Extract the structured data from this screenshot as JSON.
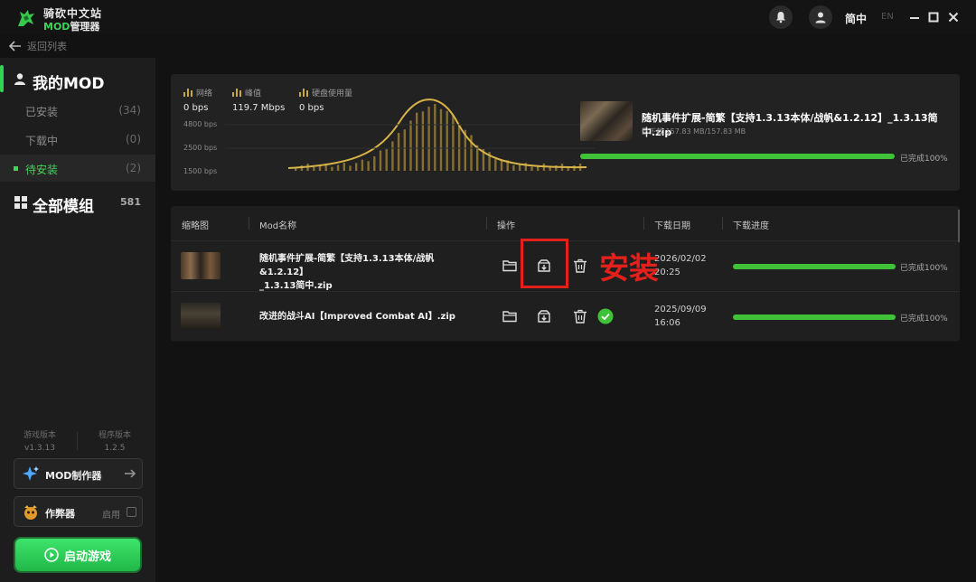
{
  "app": {
    "brand_line1": "骑砍中文站",
    "brand_mod": "MOD",
    "brand_mgr": "管理器",
    "lang_cn": "简中",
    "lang_en": "EN",
    "back_label": "返回列表"
  },
  "sidebar": {
    "my_mod": "我的MOD",
    "items": [
      {
        "label": "已安装",
        "count": "(34)"
      },
      {
        "label": "下载中",
        "count": "(0)"
      },
      {
        "label": "待安装",
        "count": "(2)"
      }
    ],
    "all_mods": "全部模组",
    "all_count": "581",
    "game_version_label": "游戏版本",
    "game_version": "v1.3.13",
    "app_version_label": "程序版本",
    "app_version": "1.2.5",
    "mod_maker": "MOD制作器",
    "cheat": "作弊器",
    "cheat_enable": "启用",
    "start_game": "启动游戏"
  },
  "download": {
    "stats": [
      {
        "label": "网络",
        "value": "0 bps"
      },
      {
        "label": "峰值",
        "value": "119.7 Mbps"
      },
      {
        "label": "硬盘使用量",
        "value": "0 bps"
      }
    ],
    "y_ticks": [
      "4800 bps",
      "2500 bps",
      "1500 bps"
    ],
    "title": "随机事件扩展-简繁【支持1.3.13本体/战帆&1.2.12】_1.3.13简中.zip",
    "size": "已下载 157.83 MB/157.83 MB",
    "progress": 1.0,
    "done_label": "已完成100%"
  },
  "table": {
    "headers": [
      "缩略图",
      "Mod名称",
      "操作",
      "下载日期",
      "下载进度"
    ],
    "rows": [
      {
        "name_line1": "随机事件扩展-简繁【支持1.3.13本体/战帆&1.2.12】",
        "name_line2": "_1.3.13简中.zip",
        "date": "2026/02/02",
        "time": "20:25",
        "progress": 1.0,
        "done_label": "已完成100%"
      },
      {
        "name_line1": "改进的战斗AI【Improved Combat AI】.zip",
        "name_line2": "",
        "date": "2025/09/09",
        "time": "16:06",
        "progress": 1.0,
        "done_label": "已完成100%"
      }
    ]
  },
  "annotation": "安装",
  "colors": {
    "accent": "#3fd45a",
    "progress": "#3fc237",
    "highlight": "#e4201c",
    "chart": "#c8a640"
  }
}
